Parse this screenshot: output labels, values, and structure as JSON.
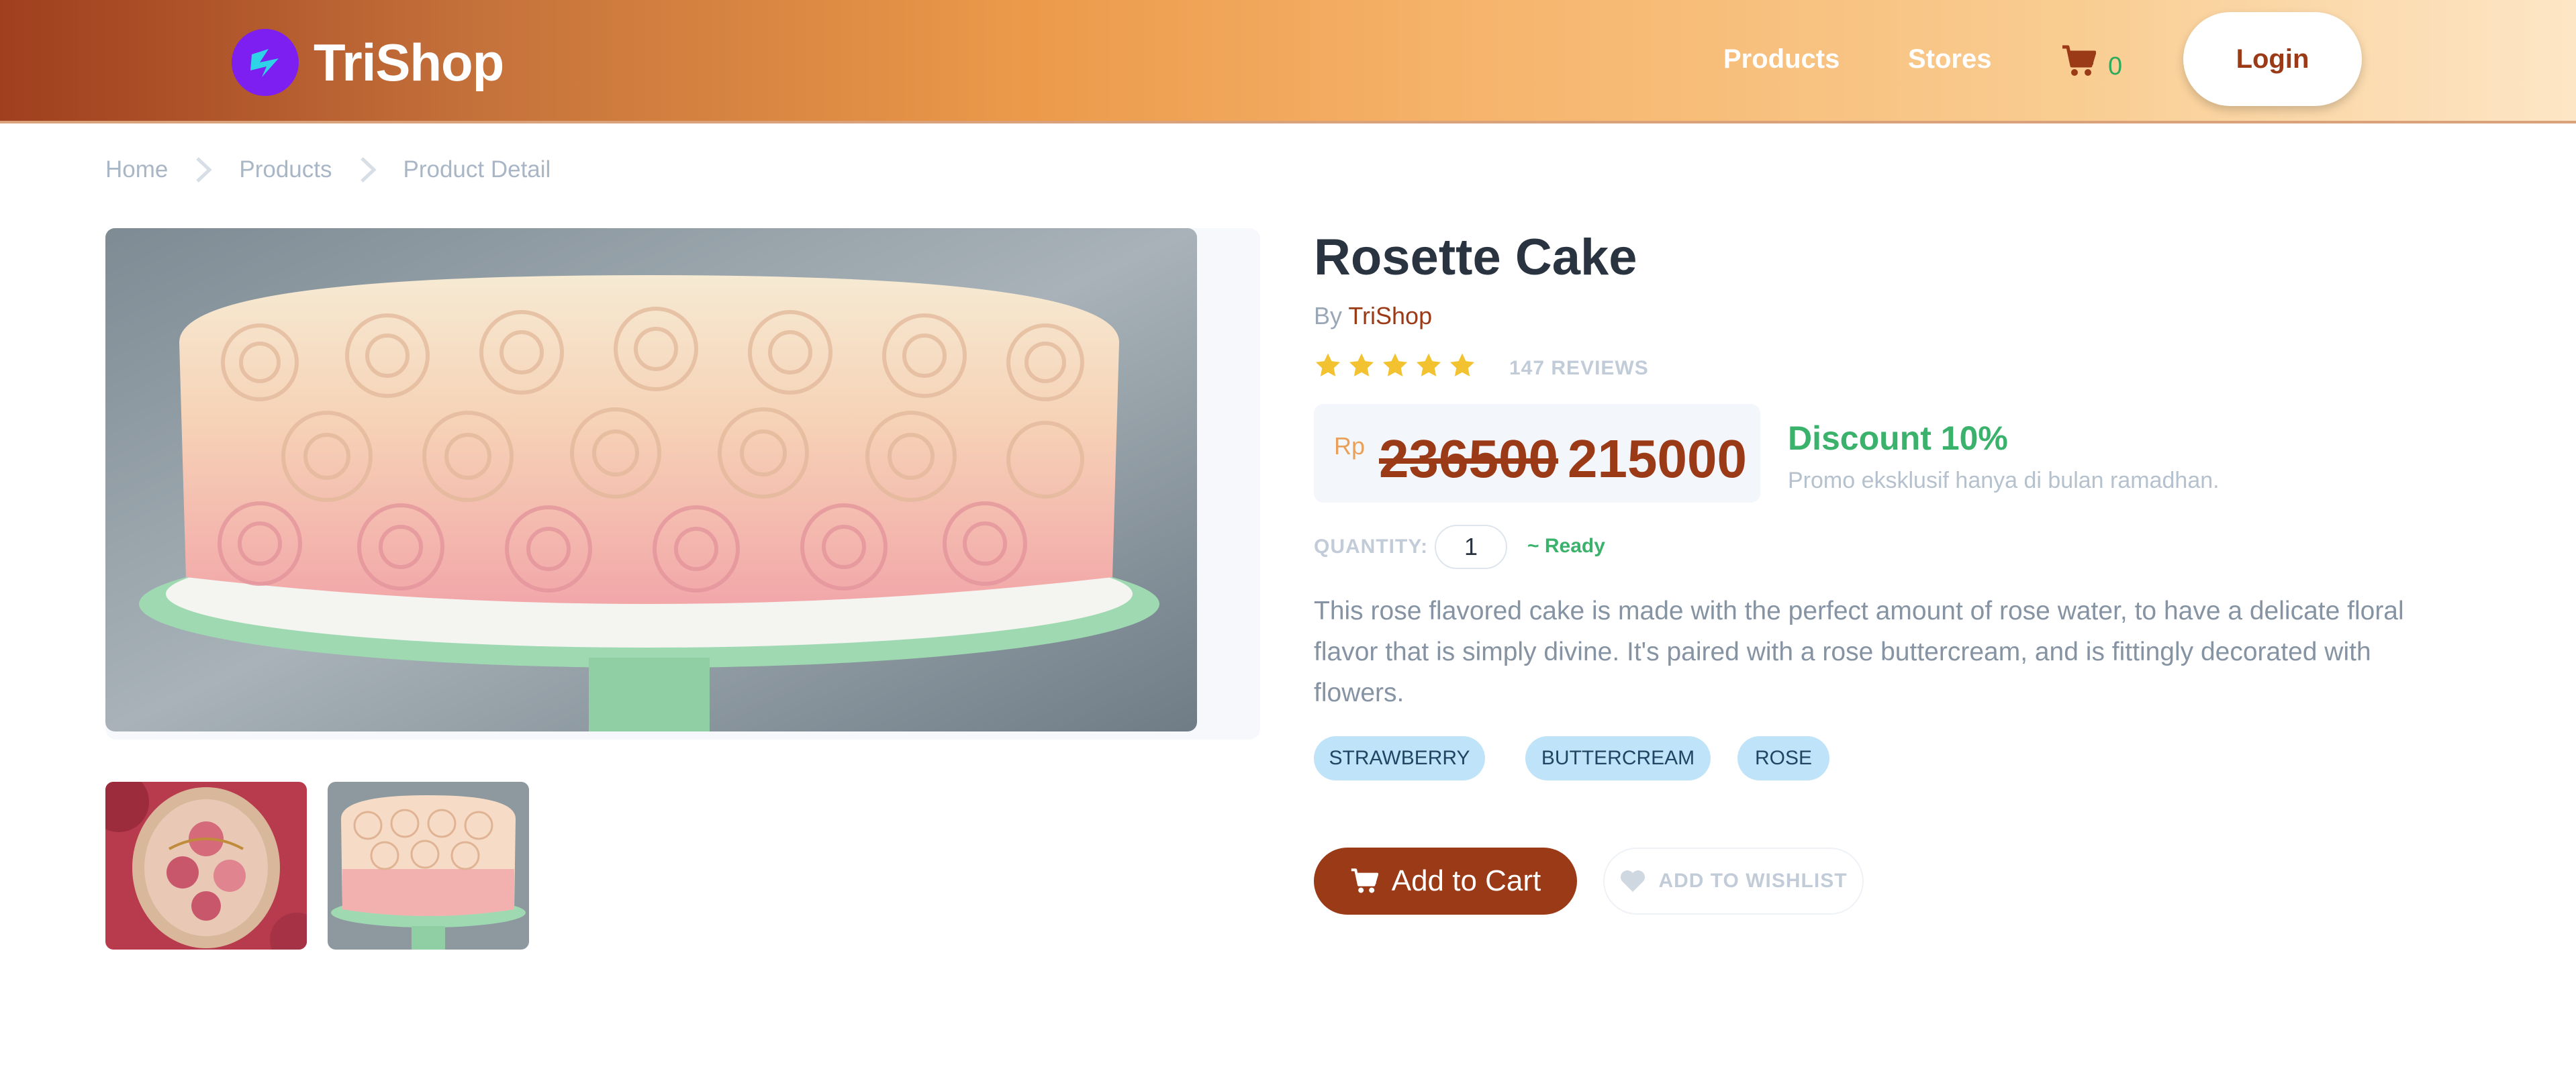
{
  "header": {
    "brand": "TriShop",
    "nav": {
      "products": "Products",
      "stores": "Stores"
    },
    "cart_count": "0",
    "login_label": "Login"
  },
  "breadcrumb": [
    "Home",
    "Products",
    "Product Detail"
  ],
  "product": {
    "title": "Rosette Cake",
    "by_prefix": "By",
    "store": "TriShop",
    "rating": 5,
    "reviews_label": "147 REVIEWS",
    "currency": "Rp",
    "old_price": "236500",
    "new_price": "215000",
    "discount_title": "Discount 10%",
    "discount_note": "Promo eksklusif hanya di bulan ramadhan.",
    "quantity_label": "QUANTITY:",
    "quantity_value": "1",
    "stock_status": "~ Ready",
    "description": "This rose flavored cake is made with the perfect amount of rose water, to have a delicate floral flavor that is simply divine. It's paired with a rose buttercream, and is fittingly decorated with flowers.",
    "tags": [
      "STRAWBERRY",
      "BUTTERCREAM",
      "ROSE"
    ],
    "add_to_cart_label": "Add to Cart",
    "wishlist_label": "ADD TO WISHLIST"
  },
  "icons": {
    "logo": "trishop-logo-icon",
    "cart": "shopping-cart-icon",
    "star": "star-icon",
    "wishlist": "heart-icon",
    "breadcrumb_separator": "chevron-right-icon"
  },
  "colors": {
    "brand": "#9b3a17",
    "star": "#f2c230",
    "success": "#3bb26c",
    "tag_bg": "#bfe3f8",
    "logo": "#7c1ff0"
  }
}
